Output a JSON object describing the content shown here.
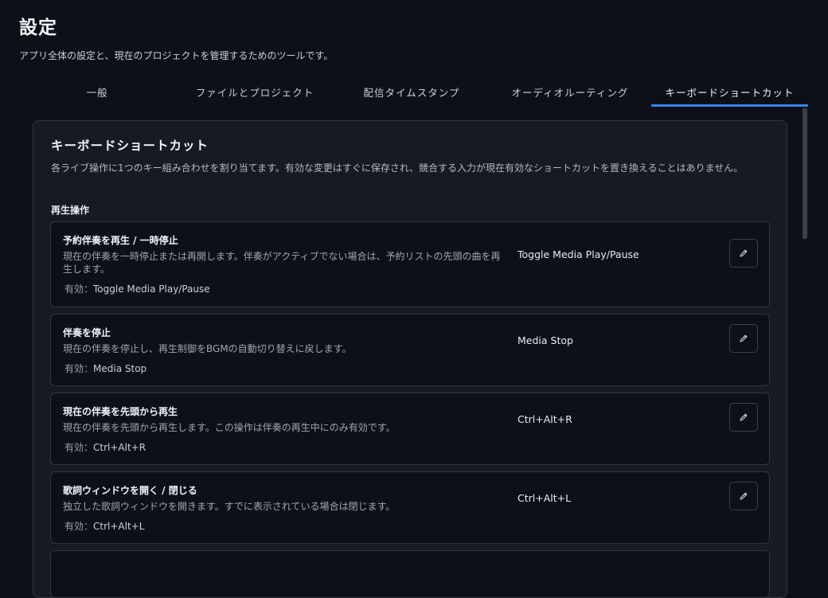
{
  "page": {
    "title": "設定",
    "subtitle": "アプリ全体の設定と、現在のプロジェクトを管理するためのツールです。"
  },
  "tabs": [
    {
      "label": "一般",
      "active": false
    },
    {
      "label": "ファイルとプロジェクト",
      "active": false
    },
    {
      "label": "配信タイムスタンプ",
      "active": false
    },
    {
      "label": "オーディオルーティング",
      "active": false
    },
    {
      "label": "キーボードショートカット",
      "active": true
    }
  ],
  "panel": {
    "title": "キーボードショートカット",
    "description": "各ライブ操作に1つのキー組み合わせを割り当てます。有効な変更はすぐに保存され、競合する入力が現在有効なショートカットを置き換えることはありません。",
    "section_label": "再生操作",
    "active_prefix": "有効：",
    "items": [
      {
        "name": "予約伴奏を再生 / 一時停止",
        "description": "現在の伴奏を一時停止または再開します。伴奏がアクティブでない場合は、予約リストの先頭の曲を再生します。",
        "shortcut": "Toggle Media Play/Pause",
        "active": "Toggle Media Play/Pause",
        "edit_icon": "pencil-icon"
      },
      {
        "name": "伴奏を停止",
        "description": "現在の伴奏を停止し、再生制御をBGMの自動切り替えに戻します。",
        "shortcut": "Media Stop",
        "active": "Media Stop",
        "edit_icon": "pencil-icon"
      },
      {
        "name": "現在の伴奏を先頭から再生",
        "description": "現在の伴奏を先頭から再生します。この操作は伴奏の再生中にのみ有効です。",
        "shortcut": "Ctrl+Alt+R",
        "active": "Ctrl+Alt+R",
        "edit_icon": "pencil-icon"
      },
      {
        "name": "歌詞ウィンドウを開く / 閉じる",
        "description": "独立した歌詞ウィンドウを開きます。すでに表示されている場合は閉じます。",
        "shortcut": "Ctrl+Alt+L",
        "active": "Ctrl+Alt+L",
        "edit_icon": "pencil-icon"
      }
    ]
  },
  "colors": {
    "background": "#0d1117",
    "panel": "#161b22",
    "border": "#30363d",
    "accent": "#3b82f6"
  }
}
